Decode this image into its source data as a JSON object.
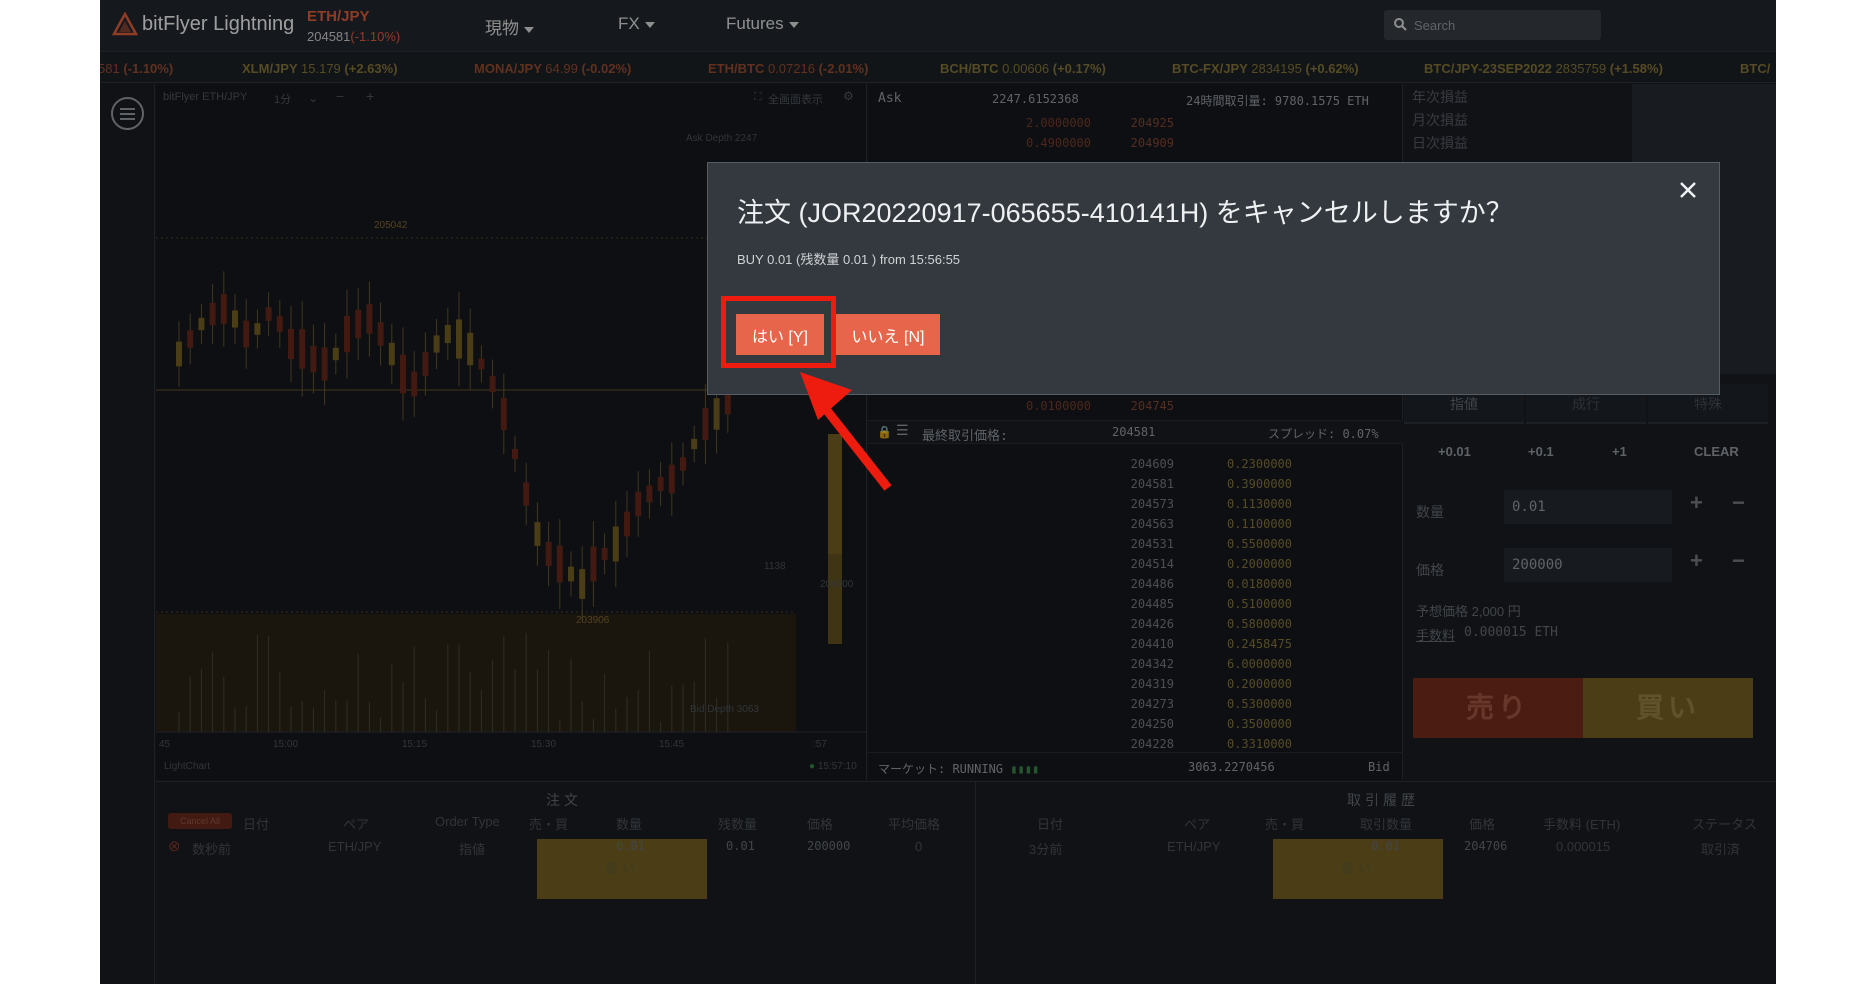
{
  "header": {
    "brand": "bitFlyer Lightning",
    "pair": {
      "name": "ETH/JPY",
      "price": "204581",
      "change": "(-1.10%)"
    },
    "nav": [
      "現物",
      "FX",
      "Futures"
    ],
    "search": {
      "placeholder": "Search"
    }
  },
  "ticker": [
    {
      "pair": "",
      "price": "581",
      "change": "(-1.10%)",
      "dir": "neg"
    },
    {
      "pair": "XLM/JPY",
      "price": "15.179",
      "change": "(+2.63%)",
      "dir": "pos"
    },
    {
      "pair": "MONA/JPY",
      "price": "64.99",
      "change": "(-0.02%)",
      "dir": "neg"
    },
    {
      "pair": "ETH/BTC",
      "price": "0.07216",
      "change": "(-2.01%)",
      "dir": "neg"
    },
    {
      "pair": "BCH/BTC",
      "price": "0.00606",
      "change": "(+0.17%)",
      "dir": "pos"
    },
    {
      "pair": "BTC-FX/JPY",
      "price": "2834195",
      "change": "(+0.62%)",
      "dir": "pos"
    },
    {
      "pair": "BTC/JPY-23SEP2022",
      "price": "2835759",
      "change": "(+1.58%)",
      "dir": "pos"
    },
    {
      "pair": "BTC/",
      "price": "",
      "change": "",
      "dir": "pos"
    }
  ],
  "chart": {
    "title": "bitFlyer ETH/JPY",
    "interval": "1分",
    "fullscreen": "全画面表示",
    "ask_depth": "Ask Depth 2247",
    "bid_depth": "Bid Depth 3063",
    "high": "205042",
    "low": "203906",
    "right_price": "204000",
    "mid_label": "1138",
    "times": [
      "45",
      "15:00",
      "15:15",
      "15:30",
      "15:45",
      ":57"
    ],
    "footer_left": "LightChart",
    "footer_right": "15:57:10"
  },
  "book": {
    "ask_label": "Ask",
    "ask_total": "2247.6152368",
    "volume": "24時間取引量: 9780.1575 ETH",
    "asks": [
      {
        "qty": "2.0000000",
        "price": "204925"
      },
      {
        "qty": "0.4900000",
        "price": "204909"
      },
      {
        "qty": "0.0100000",
        "price": "204745"
      }
    ],
    "last_label": "最終取引価格:",
    "last_price": "204581",
    "spread": "スプレッド: 0.07%",
    "bids": [
      {
        "price": "204609",
        "qty": "0.2300000"
      },
      {
        "price": "204581",
        "qty": "0.3900000"
      },
      {
        "price": "204573",
        "qty": "0.1130000"
      },
      {
        "price": "204563",
        "qty": "0.1100000"
      },
      {
        "price": "204531",
        "qty": "0.5500000"
      },
      {
        "price": "204514",
        "qty": "0.2000000"
      },
      {
        "price": "204486",
        "qty": "0.0180000"
      },
      {
        "price": "204485",
        "qty": "0.5100000"
      },
      {
        "price": "204426",
        "qty": "0.5800000"
      },
      {
        "price": "204410",
        "qty": "0.2458475"
      },
      {
        "price": "204342",
        "qty": "6.0000000"
      },
      {
        "price": "204319",
        "qty": "0.2000000"
      },
      {
        "price": "204273",
        "qty": "0.5300000"
      },
      {
        "price": "204250",
        "qty": "0.3500000"
      },
      {
        "price": "204228",
        "qty": "0.3310000"
      }
    ],
    "market": "マーケット: RUNNING",
    "bid_total": "3063.2270456",
    "bid_label": "Bid"
  },
  "panel": {
    "pl": [
      "年次損益",
      "月次損益",
      "日次損益"
    ],
    "tabs": [
      "指値",
      "成行",
      "特殊"
    ],
    "quick": [
      "+0.01",
      "+0.1",
      "+1",
      "CLEAR"
    ],
    "qty_label": "数量",
    "qty_value": "0.01",
    "price_label": "価格",
    "price_value": "200000",
    "est": "予想価格 2,000 円",
    "fee_label": "手数料",
    "fee_value": "0.000015 ETH",
    "sell": "売り",
    "buy": "買い"
  },
  "orders": {
    "title": "注文",
    "cancel_all": "Cancel All",
    "headers": [
      "日付",
      "ペア",
      "Order Type",
      "売・買",
      "数量",
      "残数量",
      "価格",
      "平均価格"
    ],
    "row": [
      "数秒前",
      "ETH/JPY",
      "指値",
      "買い",
      "0.01",
      "0.01",
      "200000",
      "0"
    ]
  },
  "history": {
    "title": "取引履歴",
    "headers": [
      "日付",
      "ペア",
      "売・買",
      "取引数量",
      "価格",
      "手数料 (ETH)",
      "ステータス"
    ],
    "row": [
      "3分前",
      "ETH/JPY",
      "買い",
      "0.01",
      "204706",
      "0.000015",
      "取引済"
    ]
  },
  "modal": {
    "title": "注文 (JOR20220917-065655-410141H) をキャンセルしますか？",
    "subtitle": "BUY 0.01 (残数量 0.01 ) from 15:56:55",
    "yes": "はい [Y]",
    "no": "いいえ [N]"
  },
  "colors": {
    "accent": "#e7654a",
    "highlight": "#ee1c0e",
    "ask": "#8a4a34",
    "bid": "#8a7a3b"
  }
}
